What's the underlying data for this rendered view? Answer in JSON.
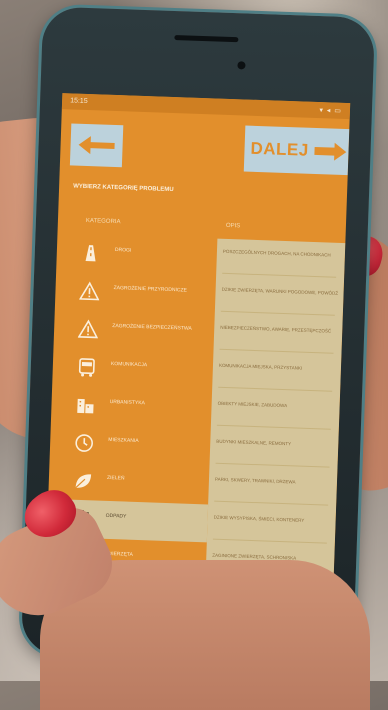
{
  "status_bar": {
    "time": "15:15",
    "icons": "▾ ◂ ▭"
  },
  "header": {
    "back_icon": "arrow-left-icon",
    "next_label": "DALEJ",
    "next_icon": "arrow-right-icon",
    "section_title": "WYBIERZ KATEGORIĘ PROBLEMU"
  },
  "columns": {
    "left": "KATEGORIA",
    "right": "OPIS"
  },
  "categories": [
    {
      "label": "DROGI",
      "icon": "road-icon"
    },
    {
      "label": "ZAGROŻENIE PRZYRODNICZE",
      "icon": "warning-icon"
    },
    {
      "label": "ZAGROŻENIE BEZPIECZEŃSTWA",
      "icon": "warning-icon"
    },
    {
      "label": "KOMUNIKACJA",
      "icon": "bus-icon"
    },
    {
      "label": "URBANISTYKA",
      "icon": "buildings-icon"
    },
    {
      "label": "MIESZKANIA",
      "icon": "clock-icon"
    },
    {
      "label": "ZIELEŃ",
      "icon": "leaf-icon"
    },
    {
      "label": "ODPADY",
      "icon": "trash-icon"
    },
    {
      "label": "ZWIERZĘTA",
      "icon": "paw-icon"
    }
  ],
  "selected_index": 7,
  "descriptions": [
    "POSZCZEGÓLNYCH DROGACH, NA CHODNIKACH",
    "DZIKIE ZWIERZĘTA, WARUNKI POGODOWE, POWÓDŹ",
    "NIEBEZPIECZEŃSTWO, AWARIE, PRZESTĘPCZOŚĆ",
    "KOMUNIKACJA MIEJSKA, PRZYSTANKI",
    "OBIEKTY MIEJSKIE, ZABUDOWA",
    "BUDYNKI MIESZKALNE, REMONTY",
    "PARKI, SKWERY, TRAWNIKI, DRZEWA",
    "DZIKIE WYSYPISKA, ŚMIECI, KONTENERY",
    "ZAGINIONE ZWIERZĘTA, SCHRONISKA"
  ],
  "colors": {
    "screen": "#e28f2c",
    "button": "#bcd2dc",
    "panel": "#d5c59a",
    "nail": "#d12a3a"
  }
}
